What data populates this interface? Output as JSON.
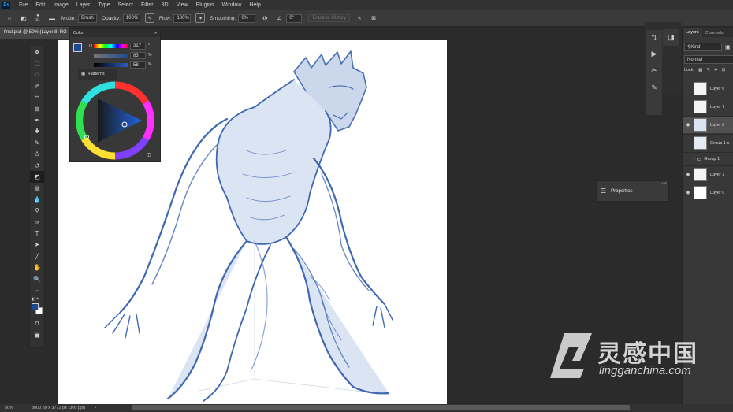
{
  "menubar": {
    "app_logo": "Ps",
    "items": [
      "File",
      "Edit",
      "Image",
      "Layer",
      "Type",
      "Select",
      "Filter",
      "3D",
      "View",
      "Plugins",
      "Window",
      "Help"
    ]
  },
  "options": {
    "brush_size": "31",
    "mode_label": "Mode:",
    "mode_value": "Brush",
    "opacity_label": "Opacity:",
    "opacity_value": "100%",
    "flow_label": "Flow:",
    "flow_value": "100%",
    "smoothing_label": "Smoothing:",
    "smoothing_value": "0%",
    "angle_value": "0°",
    "erase_history": "Erase to History"
  },
  "document": {
    "tab_title": "final.psd @ 50% (Layer 8, RG"
  },
  "color_panel": {
    "title": "Color",
    "h_label": "H",
    "values": [
      "217",
      "83",
      "58"
    ],
    "units": [
      "°",
      "%",
      "%"
    ],
    "patterns_label": "Patterns",
    "fg_color": "#1e4b8f"
  },
  "layers_panel": {
    "tabs": [
      "Layers",
      "Channels"
    ],
    "kind_filter": "Kind",
    "blend_mode": "Normal",
    "lock_label": "Lock:",
    "layers": [
      {
        "name": "Layer 6",
        "visible": false,
        "selected": false
      },
      {
        "name": "Layer 7",
        "visible": false,
        "selected": false
      },
      {
        "name": "Layer 8",
        "visible": true,
        "selected": true
      },
      {
        "name": "Group 1 c",
        "visible": false,
        "selected": false
      },
      {
        "name": "Group 1",
        "visible": false,
        "selected": false
      },
      {
        "name": "Layer 1",
        "visible": true,
        "selected": false
      },
      {
        "name": "Layer 0",
        "visible": true,
        "selected": false
      }
    ]
  },
  "properties_panel": {
    "title": "Properties"
  },
  "status": {
    "zoom": "50%",
    "doc_info": "3000 px x 3772 px (300 ppi)"
  },
  "watermark": {
    "cn_text": "灵感中国",
    "url": "lingganchina.com"
  },
  "colors": {
    "sketch_blue": "#3f68b3",
    "ui_dark": "#2b2b2b"
  }
}
